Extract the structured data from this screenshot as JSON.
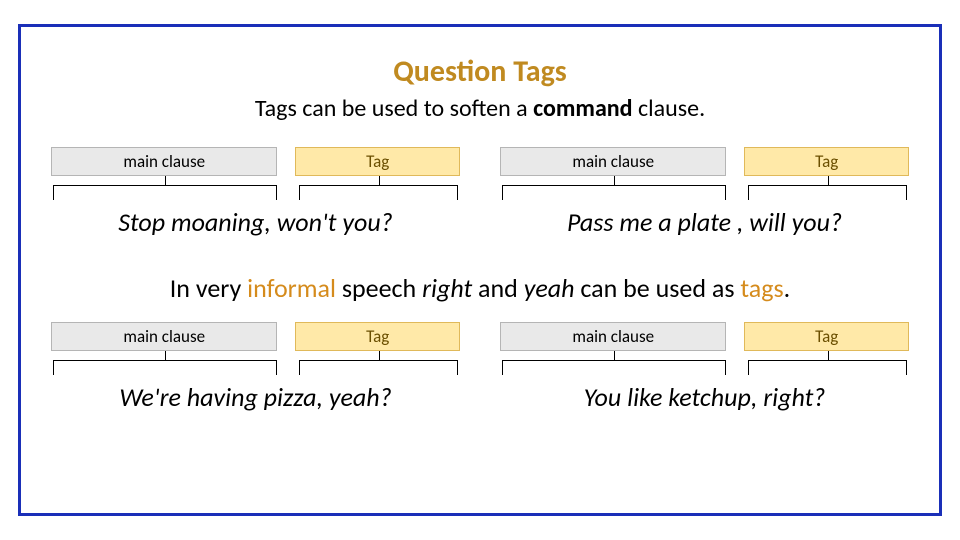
{
  "title": "Question Tags",
  "subtitle_pre": "Tags can be used to soften a ",
  "subtitle_bold": "command",
  "subtitle_post": " clause.",
  "labels": {
    "main_clause": "main clause",
    "tag": "Tag"
  },
  "examples_top": [
    {
      "main": "Stop moaning",
      "tag": ", won't you?"
    },
    {
      "main": "Pass me a plate ",
      "tag": ", will you?"
    }
  ],
  "midline": {
    "p1": "In very ",
    "informal": "informal",
    "p2": " speech ",
    "right": "right",
    "p3": " and ",
    "yeah": "yeah",
    "p4": " can be used as ",
    "tags": "tags",
    "p5": "."
  },
  "examples_bottom": [
    {
      "main": "We're having pizza",
      "tag": ", yeah?"
    },
    {
      "main": "You like ketchup",
      "tag": ", right?"
    }
  ]
}
